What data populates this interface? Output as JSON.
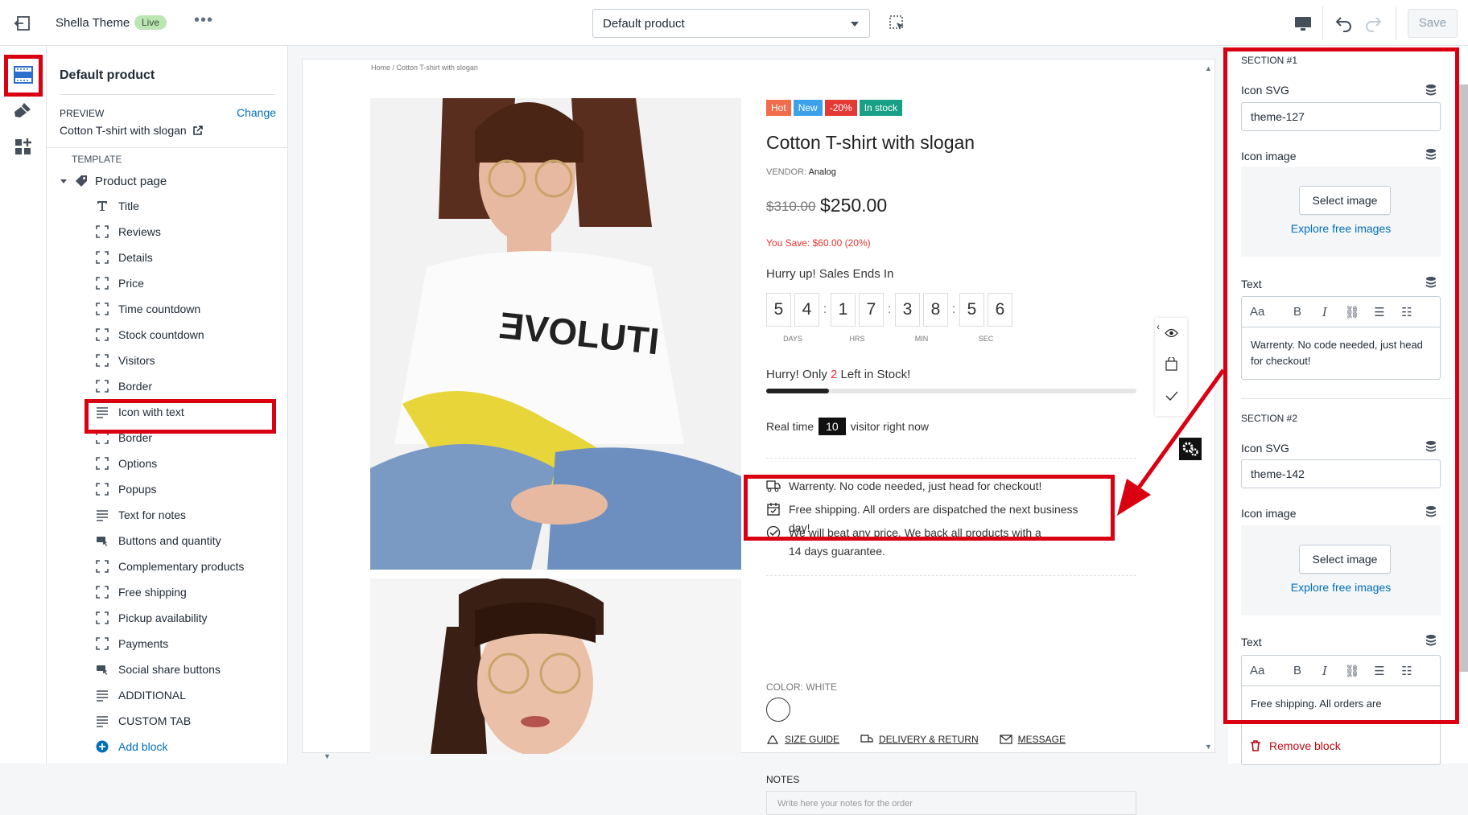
{
  "topbar": {
    "theme_name": "Shella Theme",
    "live_badge": "Live",
    "more": "•••",
    "template_select": "Default product",
    "save_label": "Save"
  },
  "sidebar": {
    "title": "Default product",
    "preview_label": "PREVIEW",
    "change_link": "Change",
    "preview_product": "Cotton T-shirt with slogan",
    "template_label": "TEMPLATE",
    "product_page": "Product page",
    "blocks": [
      {
        "label": "Title",
        "icon": "title-icon"
      },
      {
        "label": "Reviews",
        "icon": "block-icon"
      },
      {
        "label": "Details",
        "icon": "block-icon"
      },
      {
        "label": "Price",
        "icon": "block-icon"
      },
      {
        "label": "Time countdown",
        "icon": "block-icon"
      },
      {
        "label": "Stock countdown",
        "icon": "block-icon"
      },
      {
        "label": "Visitors",
        "icon": "block-icon"
      },
      {
        "label": "Border",
        "icon": "block-icon"
      },
      {
        "label": "Icon with text",
        "icon": "text-lines-icon"
      },
      {
        "label": "Border",
        "icon": "block-icon"
      },
      {
        "label": "Options",
        "icon": "block-icon"
      },
      {
        "label": "Popups",
        "icon": "block-icon"
      },
      {
        "label": "Text for notes",
        "icon": "text-lines-icon"
      },
      {
        "label": "Buttons and quantity",
        "icon": "buy-buttons-icon"
      },
      {
        "label": "Complementary products",
        "icon": "block-icon"
      },
      {
        "label": "Free shipping",
        "icon": "block-icon"
      },
      {
        "label": "Pickup availability",
        "icon": "block-icon"
      },
      {
        "label": "Payments",
        "icon": "block-icon"
      },
      {
        "label": "Social share buttons",
        "icon": "buy-buttons-icon"
      },
      {
        "label": "ADDITIONAL",
        "icon": "text-lines-icon"
      },
      {
        "label": "CUSTOM TAB",
        "icon": "text-lines-icon"
      }
    ],
    "add_block": "Add block"
  },
  "preview": {
    "breadcrumb": "Home  /  Cotton T-shirt with slogan",
    "badges": [
      {
        "label": "Hot",
        "color": "#f06c4a"
      },
      {
        "label": "New",
        "color": "#3ba1e8"
      },
      {
        "label": "-20%",
        "color": "#e53935"
      },
      {
        "label": "In stock",
        "color": "#16a085"
      }
    ],
    "product_title": "Cotton T-shirt with slogan",
    "vendor_label": "VENDOR:",
    "vendor": "Analog",
    "old_price": "$310.00",
    "price": "$250.00",
    "you_save": "You Save: $60.00 (20%)",
    "hurry_sales": "Hurry up! Sales Ends In",
    "countdown": [
      {
        "digits": [
          "5",
          "4"
        ],
        "label": "DAYS"
      },
      {
        "digits": [
          "1",
          "7"
        ],
        "label": "HRS"
      },
      {
        "digits": [
          "3",
          "8"
        ],
        "label": "MIN"
      },
      {
        "digits": [
          "5",
          "6"
        ],
        "label": "SEC"
      }
    ],
    "stock_prefix": "Hurry! Only ",
    "stock_count": "2",
    "stock_suffix": " Left in Stock!",
    "stock_fill_fraction": 0.17,
    "visitor_prefix": "Real time",
    "visitor_count": "10",
    "visitor_suffix": "visitor right now",
    "features": [
      {
        "text": "Warrenty. No code needed, just head for checkout!",
        "icon": "truck-icon"
      },
      {
        "text": "Free shipping. All orders are dispatched the next business day!",
        "icon": "calendar-icon"
      },
      {
        "text": "We will beat any price. We back all products with a 14 days guarantee.",
        "icon": "check-circle-icon"
      }
    ],
    "color_label": "COLOR:",
    "color_value": "WHITE",
    "links": [
      "SIZE GUIDE",
      "DELIVERY & RETURN",
      "MESSAGE"
    ],
    "notes_label": "NOTES",
    "notes_placeholder": "Write here your notes for the order"
  },
  "settings": {
    "section1": {
      "heading": "SECTION #1",
      "icon_svg_label": "Icon SVG",
      "icon_svg_value": "theme-127",
      "icon_image_label": "Icon image",
      "select_image": "Select image",
      "explore": "Explore free images",
      "text_label": "Text",
      "text_value": "Warrenty. No code needed, just head for checkout!"
    },
    "section2": {
      "heading": "SECTION #2",
      "icon_svg_label": "Icon SVG",
      "icon_svg_value": "theme-142",
      "icon_image_label": "Icon image",
      "select_image": "Select image",
      "explore": "Explore free images",
      "text_label": "Text",
      "text_value": "Free shipping. All orders are"
    },
    "rte_aa": "Aa",
    "remove_block": "Remove block"
  },
  "colors": {
    "highlight": "#d90011",
    "link": "#006fbb",
    "danger": "#bf0711"
  }
}
